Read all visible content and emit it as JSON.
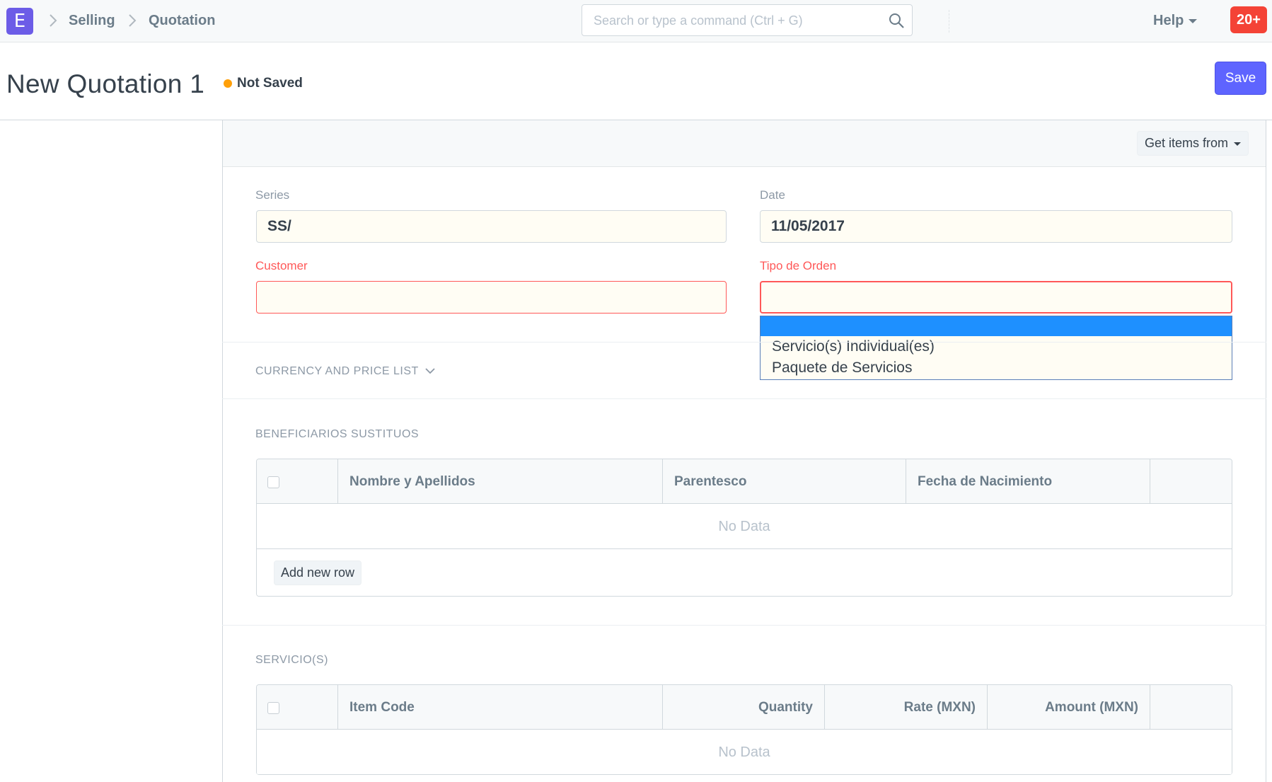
{
  "navbar": {
    "logo_letter": "E",
    "breadcrumbs": [
      "Selling",
      "Quotation"
    ],
    "search_placeholder": "Search or type a command (Ctrl + G)",
    "help_label": "Help",
    "notification_count": "20+"
  },
  "page": {
    "title": "New Quotation 1",
    "status": "Not Saved",
    "status_color": "#ffa00a",
    "save_label": "Save"
  },
  "toolbar": {
    "get_items_label": "Get items from"
  },
  "form": {
    "series": {
      "label": "Series",
      "value": "SS/"
    },
    "date": {
      "label": "Date",
      "value": "11/05/2017"
    },
    "customer": {
      "label": "Customer",
      "value": ""
    },
    "tipo_orden": {
      "label": "Tipo de Orden",
      "value": "",
      "options": [
        "",
        "Servicio(s) Individual(es)",
        "Paquete de Servicios"
      ]
    }
  },
  "sections": {
    "currency": "CURRENCY AND PRICE LIST",
    "beneficiarios": "BENEFICIARIOS SUSTITUOS",
    "servicios": "SERVICIO(S)"
  },
  "grid_beneficiarios": {
    "columns": [
      "Nombre y Apellidos",
      "Parentesco",
      "Fecha de Nacimiento"
    ],
    "empty_text": "No Data",
    "add_row_label": "Add new row"
  },
  "grid_servicios": {
    "columns": [
      "Item Code",
      "Quantity",
      "Rate (MXN)",
      "Amount (MXN)"
    ],
    "empty_text": "No Data"
  }
}
